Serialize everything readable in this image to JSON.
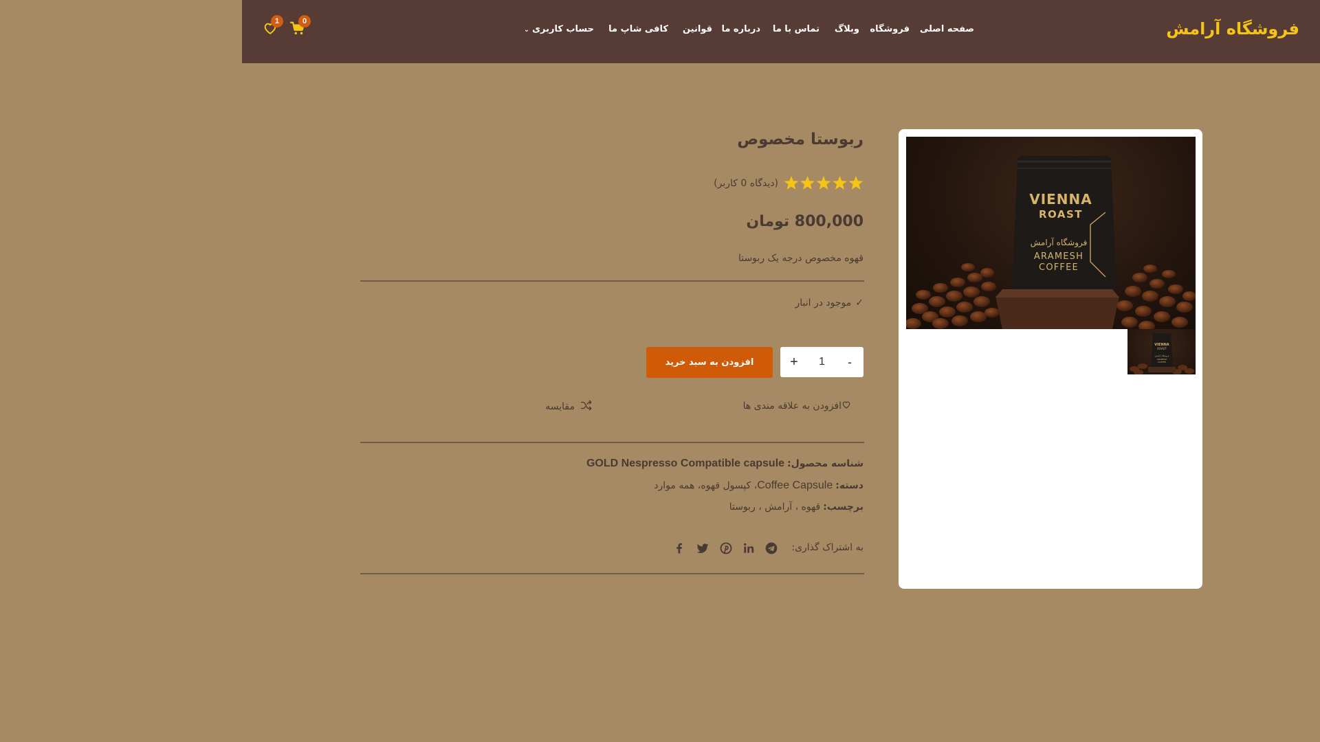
{
  "header": {
    "logo_text": "فروشگاه آرامش",
    "nav": {
      "home": "صفحه اصلی",
      "shop": "فروشگاه",
      "blog": "وبلاگ",
      "contact": "تماس با ما",
      "about": "درباره ما",
      "rules": "قوانین",
      "cafe": "کافی شاپ ما",
      "account": "حساب کاربری"
    },
    "cart_count": "0",
    "wishlist_count": "1"
  },
  "product": {
    "title": "ربوستا مخصوص",
    "rating_stars": 5,
    "review_count": "(دیدگاه 0 کاربر)",
    "price": "800,000 تومان",
    "short_description": "قهوه مخصوص درجه یک ربوستا",
    "stock_status": "موجود در انبار",
    "quantity": "1",
    "add_to_cart_label": "افزودن به سبد خرید",
    "wishlist_label": "افزودن به علاقه مندی ها",
    "compare_label": "مقایسه",
    "sku_label": "شناسه محصول:",
    "sku_value": "GOLD Nespresso Compatible capsule",
    "category_label": "دسته:",
    "category_en": "Coffee Capsule",
    "category_fa": "، کپسول قهوه، همه موارد",
    "tags_label": "برچسب:",
    "tags_value": "قهوه ، آرامش ، ربوستا",
    "share_label": "به اشتراک گذاری:"
  },
  "image": {
    "bag_line1": "VIENNA",
    "bag_line2": "ROAST",
    "bag_line3": "فروشگاه آرامش",
    "bag_line4": "ARAMESH",
    "bag_line5": "COFFEE"
  },
  "colors": {
    "header_bg": "#573b35",
    "page_bg": "#a58a63",
    "logo": "#f6c417",
    "accent": "#cf5a08",
    "badge": "#d05e12",
    "star": "#f6c417"
  },
  "icons": {
    "cart": "cart-icon",
    "wishlist": "heart-icon",
    "compare": "shuffle-icon",
    "stock": "check-icon",
    "share": [
      "telegram-icon",
      "linkedin-icon",
      "pinterest-icon",
      "twitter-icon",
      "facebook-icon"
    ]
  }
}
